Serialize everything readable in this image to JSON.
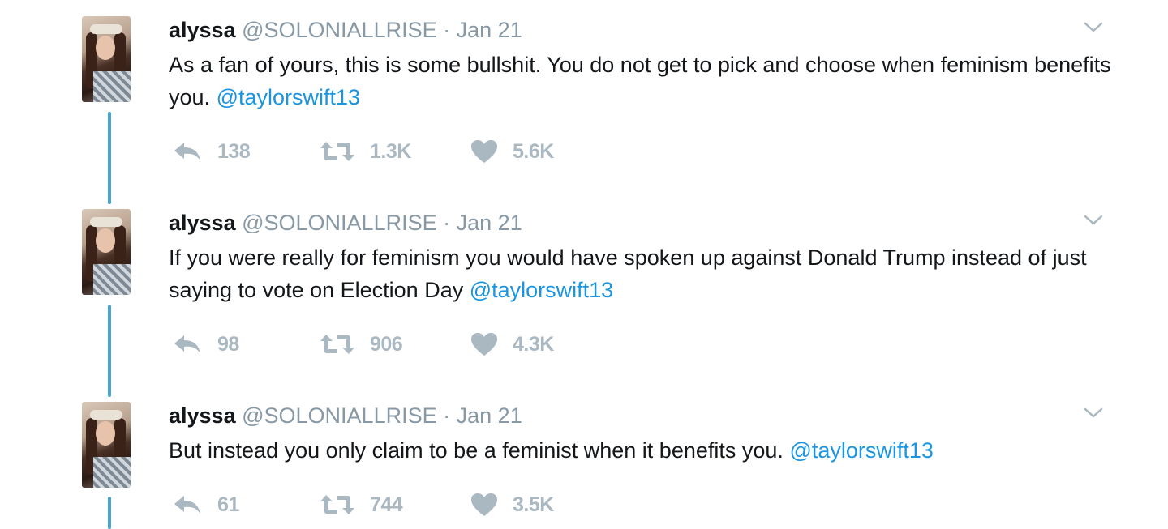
{
  "tweets": [
    {
      "name": "alyssa",
      "handle": "@SOLONIALLRISE",
      "dot": "·",
      "date": "Jan 21",
      "text": "As a fan of yours, this is some bullshit. You do not get to pick and choose when feminism benefits you.",
      "mention": "@taylorswift13",
      "replies": "138",
      "retweets": "1.3K",
      "likes": "5.6K"
    },
    {
      "name": "alyssa",
      "handle": "@SOLONIALLRISE",
      "dot": "·",
      "date": "Jan 21",
      "text": "If you were really for feminism you would have spoken up against Donald Trump instead of just saying to vote on Election Day",
      "mention": "@taylorswift13",
      "replies": "98",
      "retweets": "906",
      "likes": "4.3K"
    },
    {
      "name": "alyssa",
      "handle": "@SOLONIALLRISE",
      "dot": "·",
      "date": "Jan 21",
      "text": "But instead you only claim to be a feminist when it benefits you.",
      "mention": "@taylorswift13",
      "replies": "61",
      "retweets": "744",
      "likes": "3.5K"
    }
  ],
  "icons": {
    "reply": "reply-icon",
    "retweet": "retweet-icon",
    "like": "heart-icon",
    "caret": "chevron-down-icon"
  },
  "colors": {
    "name": "#14171a",
    "meta": "#8899a6",
    "mention": "#1b95e0",
    "action": "#aab8c2",
    "thread_line": "#4aa6cf"
  }
}
